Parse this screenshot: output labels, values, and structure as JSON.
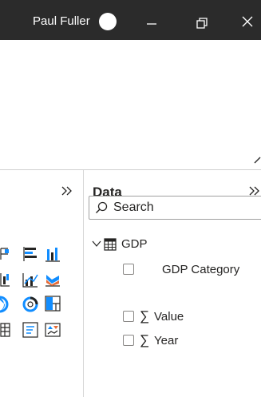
{
  "titlebar": {
    "user_name": "Paul Fuller",
    "controls": [
      "minimize-icon",
      "restore-icon",
      "close-icon"
    ]
  },
  "visualizations_pane": {
    "collapse_icon": "double-chevron-right-icon",
    "visible_icons": [
      "stacked-bar-chart-icon",
      "clustered-bar-chart-icon",
      "stacked-column-chart-icon",
      "waterfall-chart-icon",
      "line-and-column-chart-icon",
      "ribbon-chart-icon",
      "pie-chart-icon",
      "donut-chart-icon",
      "treemap-icon",
      "table-icon",
      "multi-row-card-icon",
      "kpi-icon"
    ]
  },
  "data_pane": {
    "title": "Data",
    "collapse_icon": "double-chevron-right-icon",
    "search": {
      "placeholder": "Search",
      "icon": "search-icon"
    },
    "tables": [
      {
        "name": "GDP",
        "expanded": true,
        "fields": [
          {
            "name": "GDP Category",
            "aggregate": false
          },
          {
            "name": "Value",
            "aggregate": true
          },
          {
            "name": "Year",
            "aggregate": true
          }
        ]
      }
    ]
  },
  "colors": {
    "titlebar_bg": "#2b2b2b",
    "accent_yellow": "#f2c811",
    "chart_blue": "#118dff",
    "chart_dark_blue": "#12239e",
    "chart_orange": "#e66c37"
  }
}
